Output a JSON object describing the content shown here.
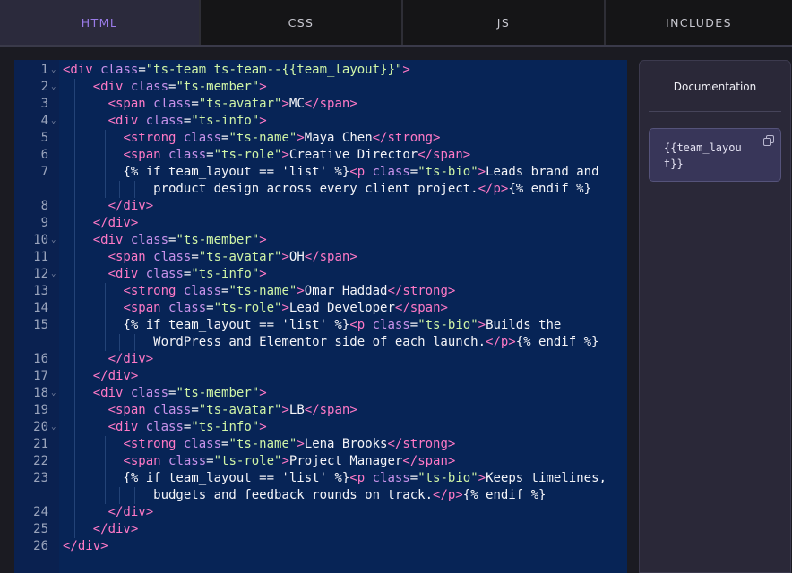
{
  "tabs": [
    {
      "label": "HTML",
      "active": true
    },
    {
      "label": "CSS",
      "active": false
    },
    {
      "label": "JS",
      "active": false
    },
    {
      "label": "INCLUDES",
      "active": false
    }
  ],
  "editor": {
    "lines": [
      {
        "n": "1",
        "fold": true,
        "segs": [
          [
            "t",
            "<div "
          ],
          [
            "a",
            "class"
          ],
          [
            "p",
            "="
          ],
          [
            "s",
            "\"ts-team ts-team--{{team_layout}}\""
          ],
          [
            "t",
            ">"
          ]
        ]
      },
      {
        "n": "2",
        "fold": true,
        "segs": [
          [
            "p",
            "    "
          ],
          [
            "t",
            "<div "
          ],
          [
            "a",
            "class"
          ],
          [
            "p",
            "="
          ],
          [
            "s",
            "\"ts-member\""
          ],
          [
            "t",
            ">"
          ]
        ]
      },
      {
        "n": "3",
        "fold": false,
        "segs": [
          [
            "p",
            "      "
          ],
          [
            "t",
            "<span "
          ],
          [
            "a",
            "class"
          ],
          [
            "p",
            "="
          ],
          [
            "s",
            "\"ts-avatar\""
          ],
          [
            "t",
            ">"
          ],
          [
            "p",
            "MC"
          ],
          [
            "t",
            "</span>"
          ]
        ]
      },
      {
        "n": "4",
        "fold": true,
        "segs": [
          [
            "p",
            "      "
          ],
          [
            "t",
            "<div "
          ],
          [
            "a",
            "class"
          ],
          [
            "p",
            "="
          ],
          [
            "s",
            "\"ts-info\""
          ],
          [
            "t",
            ">"
          ]
        ]
      },
      {
        "n": "5",
        "fold": false,
        "segs": [
          [
            "p",
            "        "
          ],
          [
            "t",
            "<strong "
          ],
          [
            "a",
            "class"
          ],
          [
            "p",
            "="
          ],
          [
            "s",
            "\"ts-name\""
          ],
          [
            "t",
            ">"
          ],
          [
            "p",
            "Maya Chen"
          ],
          [
            "t",
            "</strong>"
          ]
        ]
      },
      {
        "n": "6",
        "fold": false,
        "segs": [
          [
            "p",
            "        "
          ],
          [
            "t",
            "<span "
          ],
          [
            "a",
            "class"
          ],
          [
            "p",
            "="
          ],
          [
            "s",
            "\"ts-role\""
          ],
          [
            "t",
            ">"
          ],
          [
            "p",
            "Creative Director"
          ],
          [
            "t",
            "</span>"
          ]
        ]
      },
      {
        "n": "7",
        "fold": false,
        "segs": [
          [
            "p",
            "        {% if team_layout == 'list' %}"
          ],
          [
            "t",
            "<p "
          ],
          [
            "a",
            "class"
          ],
          [
            "p",
            "="
          ],
          [
            "s",
            "\"ts-bio\""
          ],
          [
            "t",
            ">"
          ],
          [
            "p",
            "Leads brand and"
          ]
        ]
      },
      {
        "n": "",
        "fold": false,
        "segs": [
          [
            "p",
            "            product design across every client project."
          ],
          [
            "t",
            "</p>"
          ],
          [
            "p",
            "{% endif %}"
          ]
        ]
      },
      {
        "n": "8",
        "fold": false,
        "segs": [
          [
            "p",
            "      "
          ],
          [
            "t",
            "</div>"
          ]
        ]
      },
      {
        "n": "9",
        "fold": false,
        "segs": [
          [
            "p",
            "    "
          ],
          [
            "t",
            "</div>"
          ]
        ]
      },
      {
        "n": "10",
        "fold": true,
        "segs": [
          [
            "p",
            "    "
          ],
          [
            "t",
            "<div "
          ],
          [
            "a",
            "class"
          ],
          [
            "p",
            "="
          ],
          [
            "s",
            "\"ts-member\""
          ],
          [
            "t",
            ">"
          ]
        ]
      },
      {
        "n": "11",
        "fold": false,
        "segs": [
          [
            "p",
            "      "
          ],
          [
            "t",
            "<span "
          ],
          [
            "a",
            "class"
          ],
          [
            "p",
            "="
          ],
          [
            "s",
            "\"ts-avatar\""
          ],
          [
            "t",
            ">"
          ],
          [
            "p",
            "OH"
          ],
          [
            "t",
            "</span>"
          ]
        ]
      },
      {
        "n": "12",
        "fold": true,
        "segs": [
          [
            "p",
            "      "
          ],
          [
            "t",
            "<div "
          ],
          [
            "a",
            "class"
          ],
          [
            "p",
            "="
          ],
          [
            "s",
            "\"ts-info\""
          ],
          [
            "t",
            ">"
          ]
        ]
      },
      {
        "n": "13",
        "fold": false,
        "segs": [
          [
            "p",
            "        "
          ],
          [
            "t",
            "<strong "
          ],
          [
            "a",
            "class"
          ],
          [
            "p",
            "="
          ],
          [
            "s",
            "\"ts-name\""
          ],
          [
            "t",
            ">"
          ],
          [
            "p",
            "Omar Haddad"
          ],
          [
            "t",
            "</strong>"
          ]
        ]
      },
      {
        "n": "14",
        "fold": false,
        "segs": [
          [
            "p",
            "        "
          ],
          [
            "t",
            "<span "
          ],
          [
            "a",
            "class"
          ],
          [
            "p",
            "="
          ],
          [
            "s",
            "\"ts-role\""
          ],
          [
            "t",
            ">"
          ],
          [
            "p",
            "Lead Developer"
          ],
          [
            "t",
            "</span>"
          ]
        ]
      },
      {
        "n": "15",
        "fold": false,
        "segs": [
          [
            "p",
            "        {% if team_layout == 'list' %}"
          ],
          [
            "t",
            "<p "
          ],
          [
            "a",
            "class"
          ],
          [
            "p",
            "="
          ],
          [
            "s",
            "\"ts-bio\""
          ],
          [
            "t",
            ">"
          ],
          [
            "p",
            "Builds the"
          ]
        ]
      },
      {
        "n": "",
        "fold": false,
        "segs": [
          [
            "p",
            "            WordPress and Elementor side of each launch."
          ],
          [
            "t",
            "</p>"
          ],
          [
            "p",
            "{% endif %}"
          ]
        ]
      },
      {
        "n": "16",
        "fold": false,
        "segs": [
          [
            "p",
            "      "
          ],
          [
            "t",
            "</div>"
          ]
        ]
      },
      {
        "n": "17",
        "fold": false,
        "segs": [
          [
            "p",
            "    "
          ],
          [
            "t",
            "</div>"
          ]
        ]
      },
      {
        "n": "18",
        "fold": true,
        "segs": [
          [
            "p",
            "    "
          ],
          [
            "t",
            "<div "
          ],
          [
            "a",
            "class"
          ],
          [
            "p",
            "="
          ],
          [
            "s",
            "\"ts-member\""
          ],
          [
            "t",
            ">"
          ]
        ]
      },
      {
        "n": "19",
        "fold": false,
        "segs": [
          [
            "p",
            "      "
          ],
          [
            "t",
            "<span "
          ],
          [
            "a",
            "class"
          ],
          [
            "p",
            "="
          ],
          [
            "s",
            "\"ts-avatar\""
          ],
          [
            "t",
            ">"
          ],
          [
            "p",
            "LB"
          ],
          [
            "t",
            "</span>"
          ]
        ]
      },
      {
        "n": "20",
        "fold": true,
        "segs": [
          [
            "p",
            "      "
          ],
          [
            "t",
            "<div "
          ],
          [
            "a",
            "class"
          ],
          [
            "p",
            "="
          ],
          [
            "s",
            "\"ts-info\""
          ],
          [
            "t",
            ">"
          ]
        ]
      },
      {
        "n": "21",
        "fold": false,
        "segs": [
          [
            "p",
            "        "
          ],
          [
            "t",
            "<strong "
          ],
          [
            "a",
            "class"
          ],
          [
            "p",
            "="
          ],
          [
            "s",
            "\"ts-name\""
          ],
          [
            "t",
            ">"
          ],
          [
            "p",
            "Lena Brooks"
          ],
          [
            "t",
            "</strong>"
          ]
        ]
      },
      {
        "n": "22",
        "fold": false,
        "segs": [
          [
            "p",
            "        "
          ],
          [
            "t",
            "<span "
          ],
          [
            "a",
            "class"
          ],
          [
            "p",
            "="
          ],
          [
            "s",
            "\"ts-role\""
          ],
          [
            "t",
            ">"
          ],
          [
            "p",
            "Project Manager"
          ],
          [
            "t",
            "</span>"
          ]
        ]
      },
      {
        "n": "23",
        "fold": false,
        "segs": [
          [
            "p",
            "        {% if team_layout == 'list' %}"
          ],
          [
            "t",
            "<p "
          ],
          [
            "a",
            "class"
          ],
          [
            "p",
            "="
          ],
          [
            "s",
            "\"ts-bio\""
          ],
          [
            "t",
            ">"
          ],
          [
            "p",
            "Keeps timelines,"
          ]
        ]
      },
      {
        "n": "",
        "fold": false,
        "segs": [
          [
            "p",
            "            budgets and feedback rounds on track."
          ],
          [
            "t",
            "</p>"
          ],
          [
            "p",
            "{% endif %}"
          ]
        ]
      },
      {
        "n": "24",
        "fold": false,
        "segs": [
          [
            "p",
            "      "
          ],
          [
            "t",
            "</div>"
          ]
        ]
      },
      {
        "n": "25",
        "fold": false,
        "segs": [
          [
            "p",
            "    "
          ],
          [
            "t",
            "</div>"
          ]
        ]
      },
      {
        "n": "26",
        "fold": false,
        "segs": [
          [
            "t",
            "</div>"
          ]
        ]
      }
    ]
  },
  "documentation": {
    "title": "Documentation",
    "variables": [
      "{{team_layout}}"
    ],
    "copy_icon": "copy-icon"
  },
  "colors": {
    "tag": "#ff79c6",
    "attr": "#c792ea",
    "string": "#d0f5a6",
    "text": "#f4f4f8",
    "editor_bg": "#072456",
    "active_tab": "#9a7be8"
  }
}
